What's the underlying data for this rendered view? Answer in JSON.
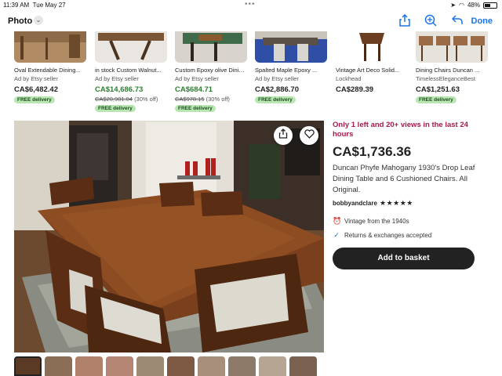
{
  "status_bar": {
    "time": "11:39 AM",
    "date": "Tue May 27",
    "battery": "48%"
  },
  "nav": {
    "title": "Photo",
    "done_label": "Done"
  },
  "listings": [
    {
      "title": "Oval Extendable Dining...",
      "seller": "Ad by Etsy seller",
      "price": "CA$6,482.42",
      "sale": false,
      "original_price": "",
      "discount": "",
      "badge": "FREE delivery"
    },
    {
      "title": "in stock Custom Walnut...",
      "seller": "Ad by Etsy seller",
      "price": "CA$14,686.73",
      "sale": true,
      "original_price": "CA$20,981.04",
      "discount": "(30% off)",
      "badge": "FREE delivery"
    },
    {
      "title": "Custom Epoxy olive Dining...",
      "seller": "Ad by Etsy seller",
      "price": "CA$684.71",
      "sale": true,
      "original_price": "CA$978.15",
      "discount": "(30% off)",
      "badge": "FREE delivery"
    },
    {
      "title": "Spalted Maple Epoxy ...",
      "seller": "Ad by Etsy seller",
      "price": "CA$2,886.70",
      "sale": false,
      "original_price": "",
      "discount": "",
      "badge": "FREE delivery"
    },
    {
      "title": "Vintage Art Deco Solid...",
      "seller": "Lockhead",
      "price": "CA$289.39",
      "sale": false,
      "original_price": "",
      "discount": "",
      "badge": ""
    },
    {
      "title": "Dining Chairs Duncan ...",
      "seller": "TimelessEleganceBest",
      "price": "CA$1,251.63",
      "sale": false,
      "original_price": "",
      "discount": "",
      "badge": "FREE delivery"
    }
  ],
  "product": {
    "scarcity": "Only 1 left and 20+ views in the last 24 hours",
    "price": "CA$1,736.36",
    "title": "Duncan Phyfe Mahogany 1930's Drop Leaf Dining Table and 6 Cushioned Chairs. All Original.",
    "shop": "bobbyandclare",
    "stars": "★★★★★",
    "vintage": "Vintage from the 1940s",
    "returns": "Returns & exchanges accepted",
    "basket_label": "Add to basket"
  },
  "colors": {
    "accent_blue": "#1a73e8",
    "scarcity_red": "#a61a4d",
    "badge_green": "#b9e6b3",
    "sale_green": "#2e7d32",
    "button_black": "#222222"
  }
}
